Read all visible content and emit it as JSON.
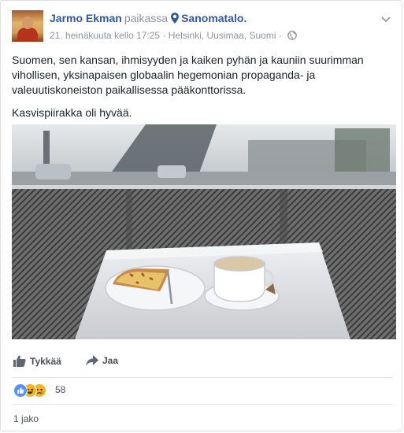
{
  "post": {
    "author": "Jarmo Ekman",
    "at_label": "paikassa",
    "place": "Sanomatalo.",
    "timestamp": "21. heinäkuuta kello 17:25",
    "location": "Helsinki, Uusimaa, Suomi",
    "paragraphs": [
      "Suomen, sen kansan, ihmisyyden ja kaiken pyhän ja kauniin suurimman vihollisen, yksinapaisen globaalin hegemonian propaganda- ja valeuutiskoneiston paikallisessa pääkonttorissa.",
      "Kasvispiirakka oli hyvää."
    ]
  },
  "actions": {
    "like_label": "Tykkää",
    "share_label": "Jaa"
  },
  "reactions": {
    "count": "58",
    "types": [
      "like-icon",
      "haha-icon",
      "sad-icon"
    ]
  },
  "shares": {
    "label": "1 jako"
  },
  "colors": {
    "link": "#365899",
    "meta": "#90949c",
    "like_blue": "#5890ff",
    "reaction_yellow": "#f7b125"
  }
}
